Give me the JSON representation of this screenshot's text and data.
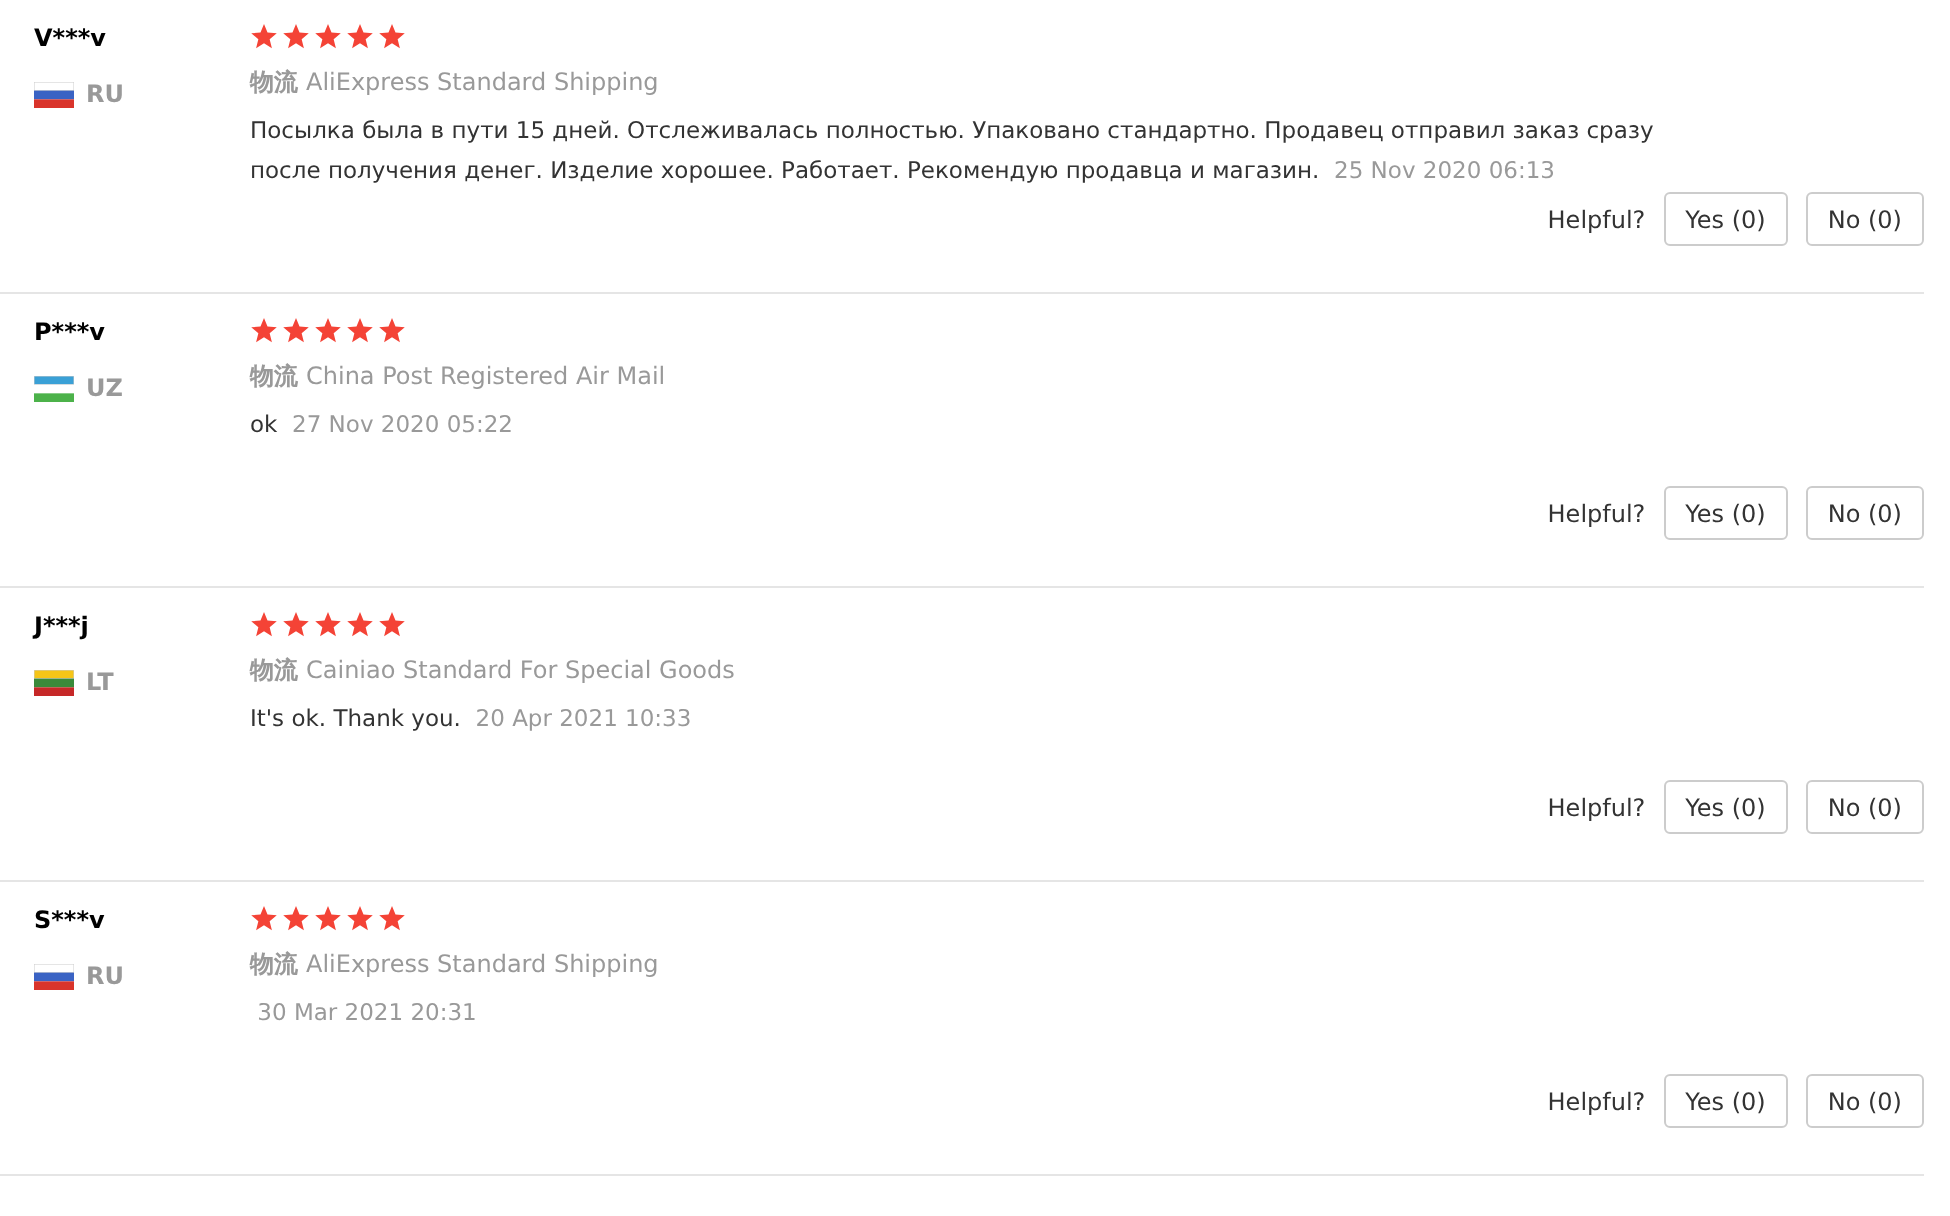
{
  "reviews": [
    {
      "name": "V***v",
      "kind": "ru",
      "country": "RU",
      "stars": 5,
      "shipping_label": "物流",
      "shipping": "AliExpress Standard Shipping",
      "text": "Посылка была в пути 15 дней. Отслеживалась полностью. Упаковано стандартно. Продавец отправил заказ сразу после получения денег. Изделие хорошее. Работает. Рекомендую продавца и магазин.",
      "date": "25 Nov 2020 06:13",
      "helpful": "Helpful?",
      "yes": "Yes (0)",
      "no": "No (0)"
    },
    {
      "name": "P***v",
      "kind": "uz",
      "country": "UZ",
      "stars": 5,
      "shipping_label": "物流",
      "shipping": "China Post Registered Air Mail",
      "text": "ok",
      "date": "27 Nov 2020 05:22",
      "helpful": "Helpful?",
      "yes": "Yes (0)",
      "no": "No (0)"
    },
    {
      "name": "J***j",
      "kind": "lt",
      "country": "LT",
      "stars": 5,
      "shipping_label": "物流",
      "shipping": "Cainiao Standard For Special Goods",
      "text": "It's ok. Thank you.",
      "date": "20 Apr 2021 10:33",
      "helpful": "Helpful?",
      "yes": "Yes (0)",
      "no": "No (0)"
    },
    {
      "name": "S***v",
      "kind": "ru",
      "country": "RU",
      "stars": 5,
      "shipping_label": "物流",
      "shipping": "AliExpress Standard Shipping",
      "date": "30 Mar 2021 20:31",
      "helpful": "Helpful?",
      "yes": "Yes (0)",
      "no": "No (0)"
    }
  ]
}
